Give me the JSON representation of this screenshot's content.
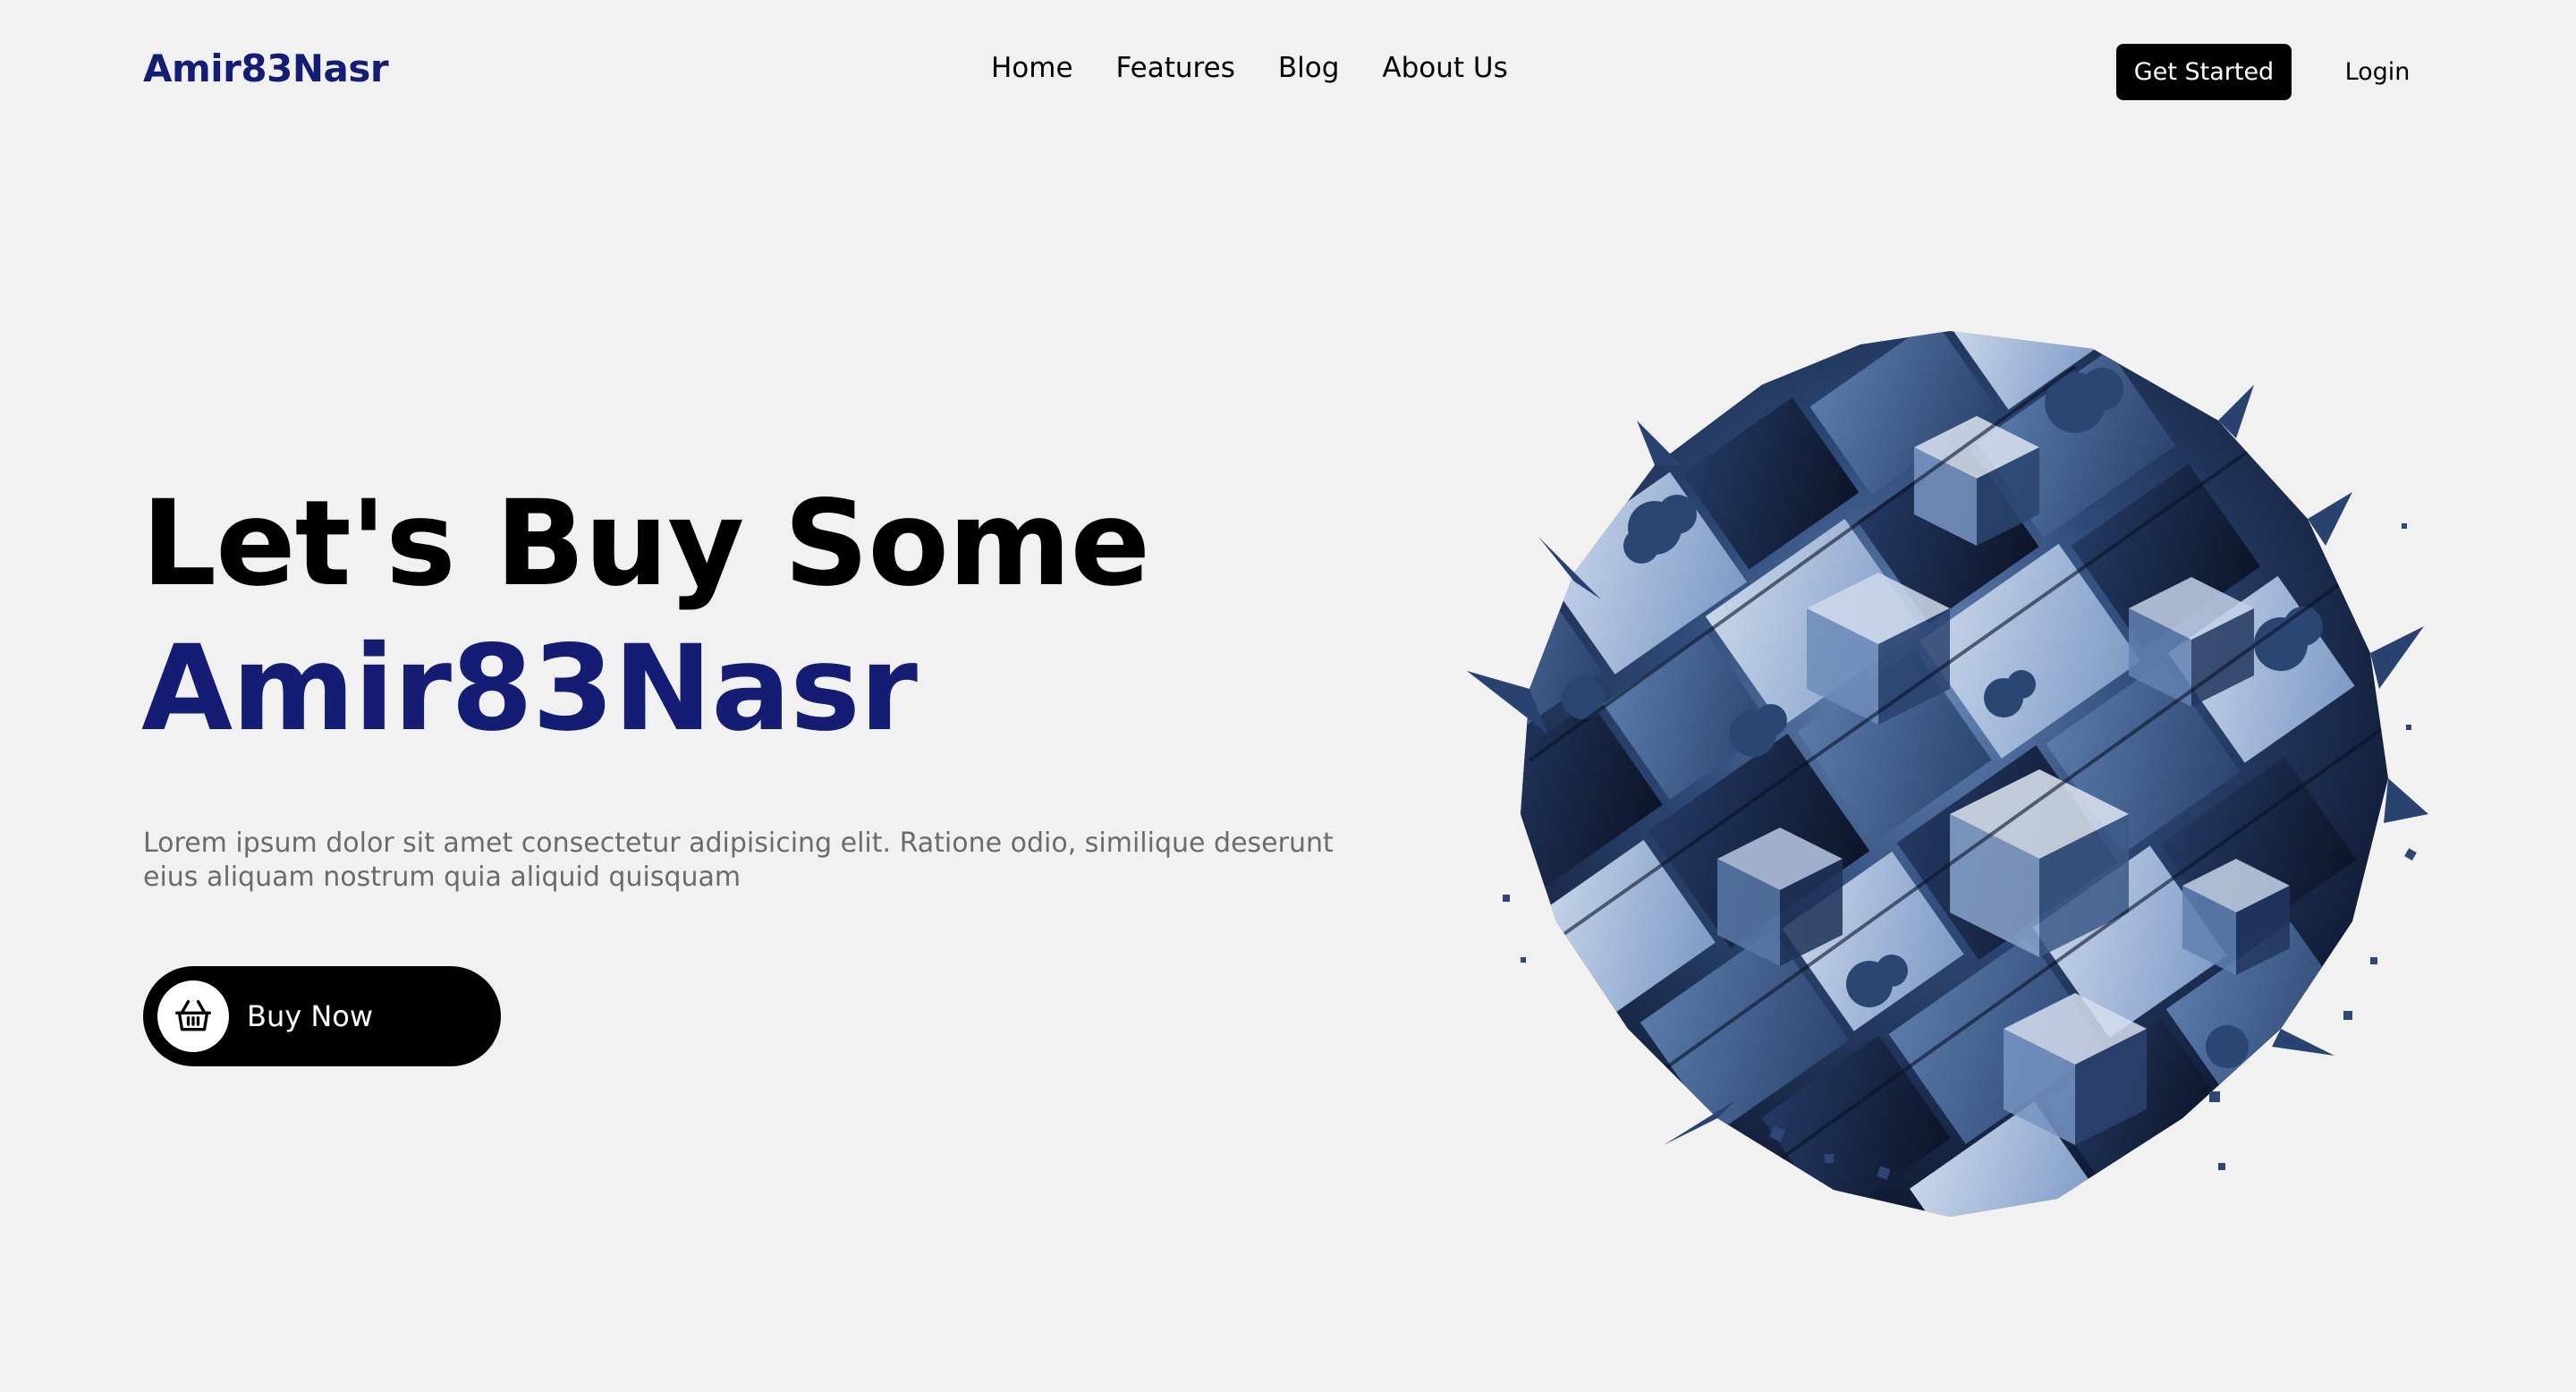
{
  "nav": {
    "logo": "Amir83Nasr",
    "links": [
      "Home",
      "Features",
      "Blog",
      "About Us"
    ],
    "get_started": "Get Started",
    "login": "Login"
  },
  "hero": {
    "title_line1": "Let's Buy Some",
    "title_line2": "Amir83Nasr",
    "description": "Lorem ipsum dolor sit amet consectetur adipisicing elit. Ratione odio, similique deserunt eius aliquam nostrum quia aliquid quisquam",
    "buy_button": "Buy Now",
    "buy_icon": "basket-icon",
    "art": "abstract-cube-sphere-artwork"
  },
  "colors": {
    "background": "#f1f1f1",
    "brand": "#141d73",
    "primary_button": "#000000",
    "text_muted": "#6b6b6b",
    "art_dark": "#1d2f52",
    "art_light": "#7d9ac6"
  }
}
